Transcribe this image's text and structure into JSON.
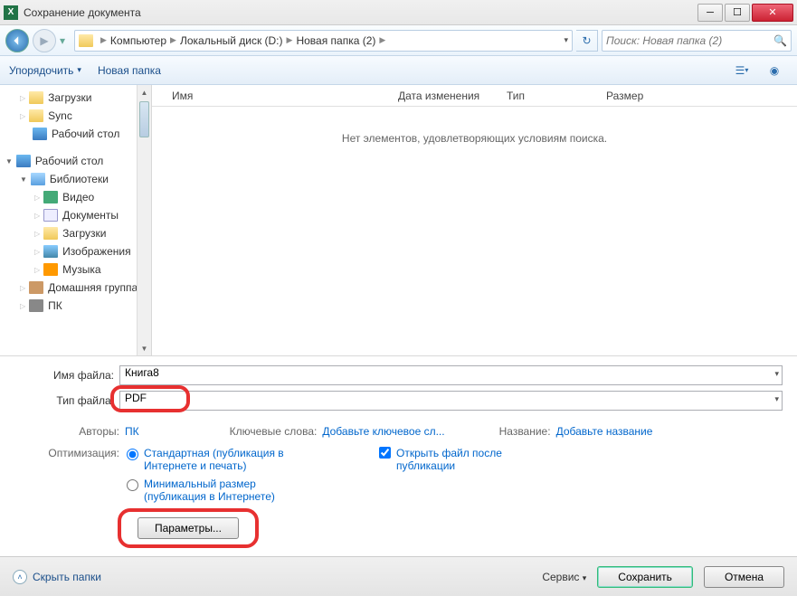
{
  "window": {
    "title": "Сохранение документа"
  },
  "breadcrumb": {
    "items": [
      "Компьютер",
      "Локальный диск (D:)",
      "Новая папка (2)"
    ]
  },
  "search": {
    "placeholder": "Поиск: Новая папка (2)"
  },
  "toolbar": {
    "organize": "Упорядочить",
    "new_folder": "Новая папка"
  },
  "sidebar": {
    "items": [
      {
        "label": "Загрузки",
        "icon": "folder",
        "level": 2
      },
      {
        "label": "Sync",
        "icon": "folder",
        "level": 2
      },
      {
        "label": "Рабочий стол",
        "icon": "desktop",
        "level": 2
      },
      {
        "label": "",
        "icon": "",
        "level": 0
      },
      {
        "label": "Рабочий стол",
        "icon": "desktop",
        "level": 1,
        "expanded": true
      },
      {
        "label": "Библиотеки",
        "icon": "lib",
        "level": 2,
        "expanded": true
      },
      {
        "label": "Видео",
        "icon": "video",
        "level": 3
      },
      {
        "label": "Документы",
        "icon": "doc",
        "level": 3
      },
      {
        "label": "Загрузки",
        "icon": "folder",
        "level": 3
      },
      {
        "label": "Изображения",
        "icon": "img",
        "level": 3
      },
      {
        "label": "Музыка",
        "icon": "music",
        "level": 3
      },
      {
        "label": "Домашняя группа",
        "icon": "home",
        "level": 2
      },
      {
        "label": "ПК",
        "icon": "pc",
        "level": 2
      }
    ]
  },
  "columns": {
    "name": "Имя",
    "date": "Дата изменения",
    "type": "Тип",
    "size": "Размер"
  },
  "empty_message": "Нет элементов, удовлетворяющих условиям поиска.",
  "form": {
    "filename_label": "Имя файла:",
    "filename_value": "Книга8",
    "filetype_label": "Тип файла:",
    "filetype_value": "PDF"
  },
  "meta": {
    "authors_label": "Авторы:",
    "authors_value": "ПК",
    "keywords_label": "Ключевые слова:",
    "keywords_value": "Добавьте ключевое сл...",
    "title_label": "Название:",
    "title_value": "Добавьте название"
  },
  "optimization": {
    "label": "Оптимизация:",
    "standard": "Стандартная (публикация в Интернете и печать)",
    "minimal": "Минимальный размер (публикация в Интернете)",
    "open_after": "Открыть файл после публикации",
    "params_button": "Параметры..."
  },
  "footer": {
    "hide_folders": "Скрыть папки",
    "tools": "Сервис",
    "save": "Сохранить",
    "cancel": "Отмена"
  }
}
